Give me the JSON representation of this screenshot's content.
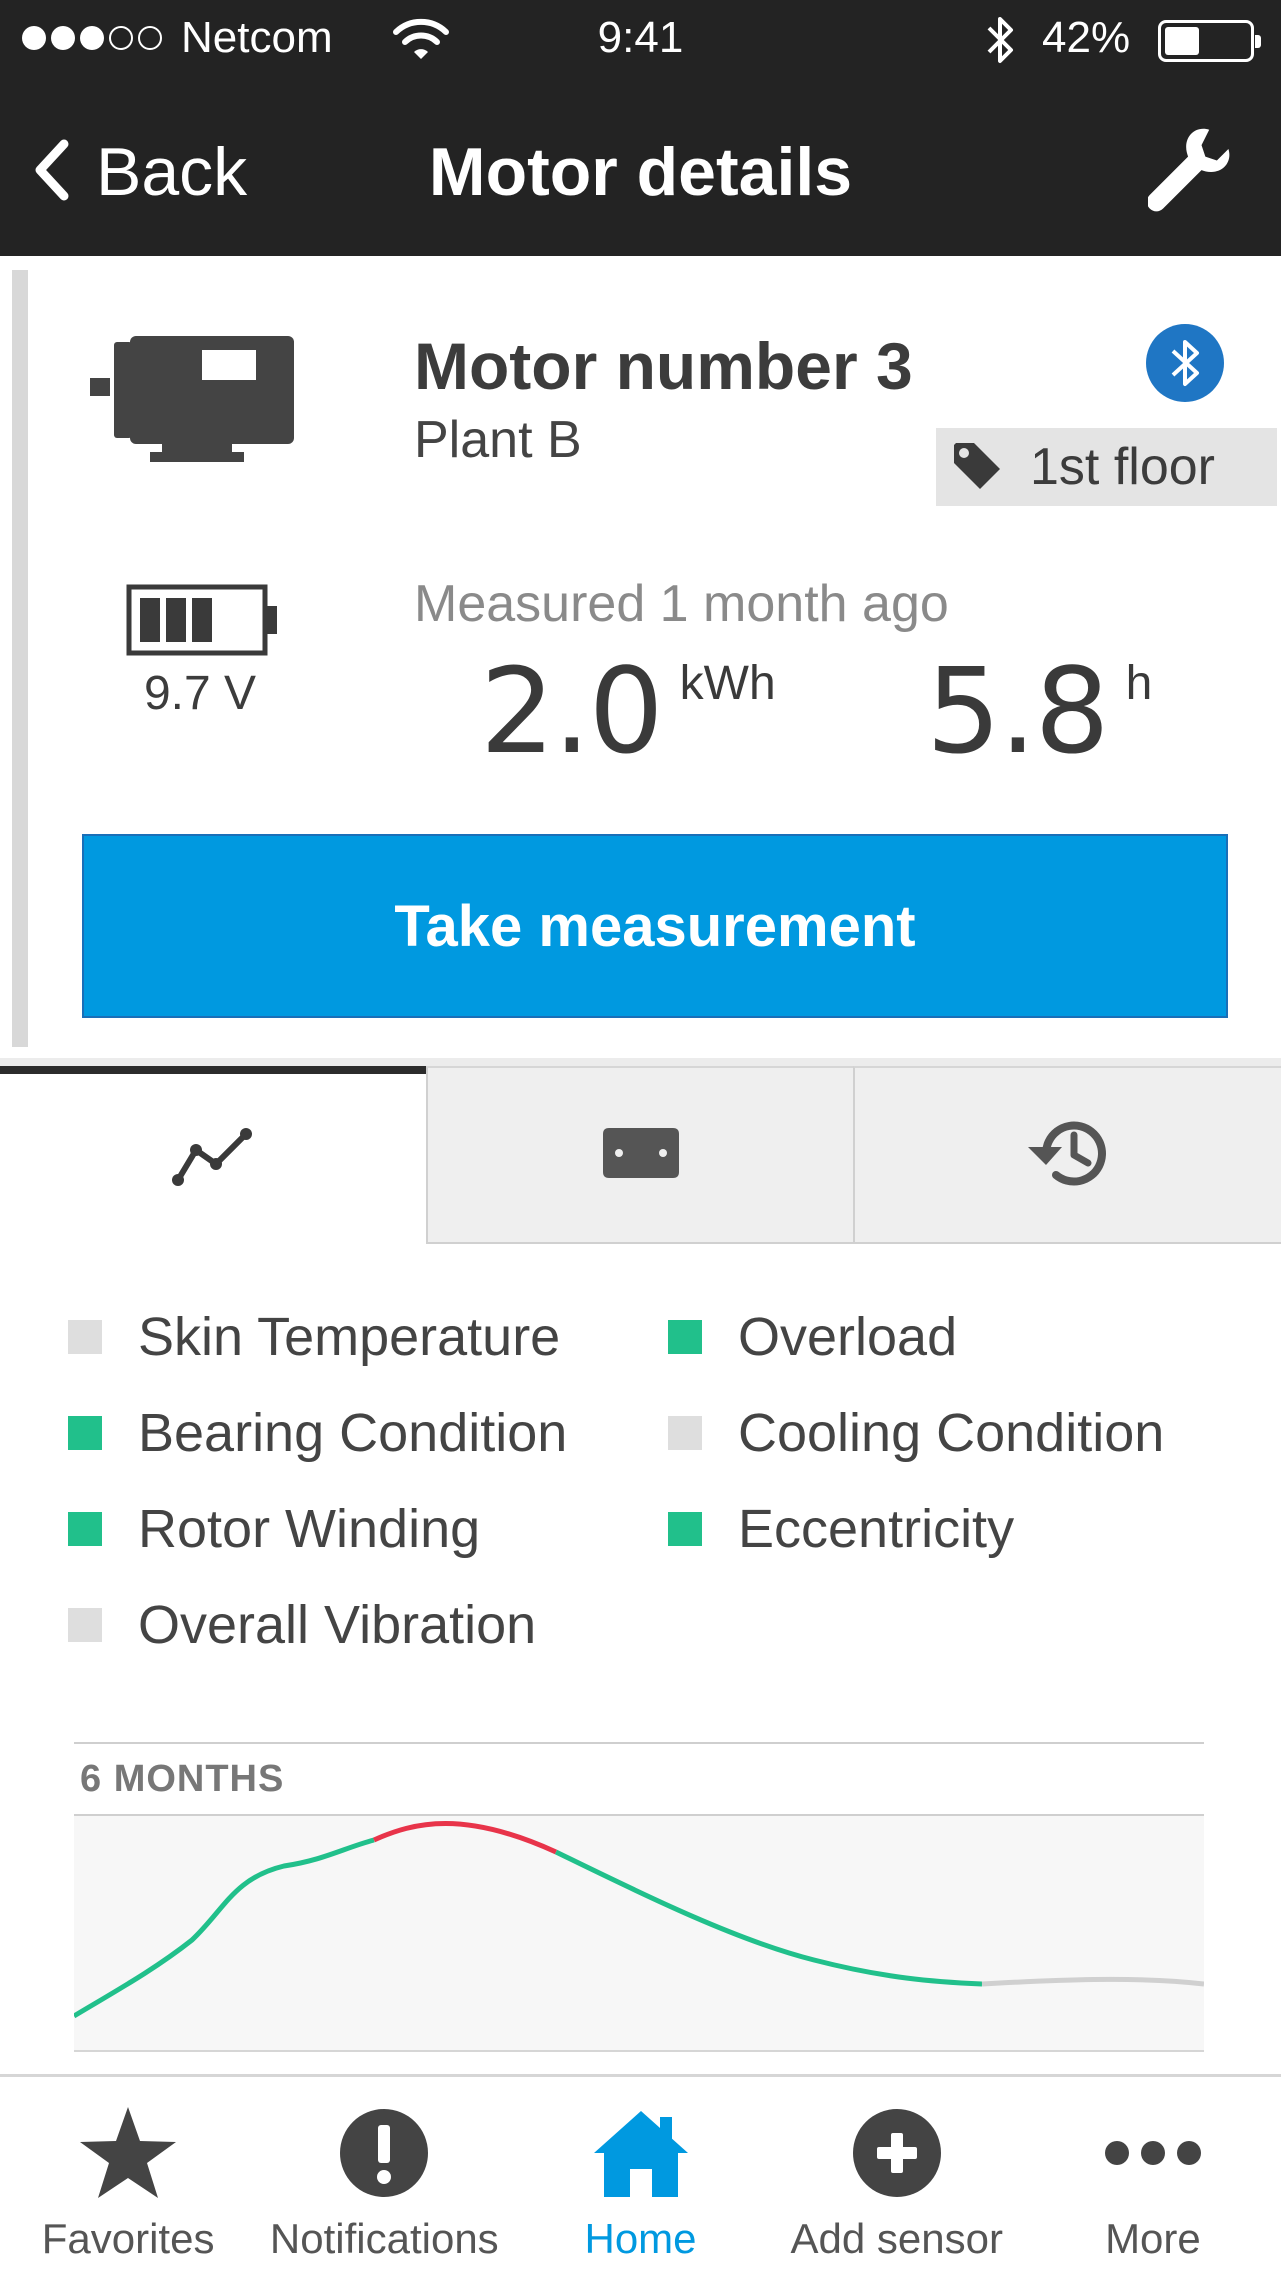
{
  "status_bar": {
    "carrier": "Netcom",
    "time": "9:41",
    "battery_percent": "42%",
    "battery_level": 0.42,
    "signal_strength": 3,
    "signal_max": 5
  },
  "nav": {
    "back_label": "Back",
    "title": "Motor details",
    "settings_icon": "wrench-icon"
  },
  "motor": {
    "name": "Motor number 3",
    "location": "Plant B",
    "tag": "1st floor",
    "battery_voltage": "9.7 V",
    "measured_text": "Measured 1 month ago",
    "energy_value": "2.0",
    "energy_unit": "kWh",
    "hours_value": "5.8",
    "hours_unit": "h",
    "measure_button": "Take measurement",
    "connection_icon": "bluetooth-icon"
  },
  "tabs": [
    {
      "icon": "trend-chart-icon",
      "active": true
    },
    {
      "icon": "sensor-icon",
      "active": false
    },
    {
      "icon": "history-icon",
      "active": false
    }
  ],
  "legend": [
    {
      "label": "Skin Temperature",
      "status": "inactive"
    },
    {
      "label": "Overload",
      "status": "ok"
    },
    {
      "label": "Bearing Condition",
      "status": "ok"
    },
    {
      "label": "Cooling Condition",
      "status": "inactive"
    },
    {
      "label": "Rotor Winding",
      "status": "ok"
    },
    {
      "label": "Eccentricity",
      "status": "ok"
    },
    {
      "label": "Overall Vibration",
      "status": "inactive"
    }
  ],
  "colors": {
    "ok": "#21c08b",
    "alert": "#e8344a",
    "inactive": "#dedede",
    "accent": "#0099e0",
    "bluetooth": "#1f76c4"
  },
  "chart": {
    "period": "6 MONTHS"
  },
  "tabbar": [
    {
      "label": "Favorites",
      "icon": "star-icon",
      "active": false
    },
    {
      "label": "Notifications",
      "icon": "exclamation-icon",
      "active": false
    },
    {
      "label": "Home",
      "icon": "home-icon",
      "active": true
    },
    {
      "label": "Add sensor",
      "icon": "plus-circle-icon",
      "active": false
    },
    {
      "label": "More",
      "icon": "more-dots-icon",
      "active": false
    }
  ]
}
